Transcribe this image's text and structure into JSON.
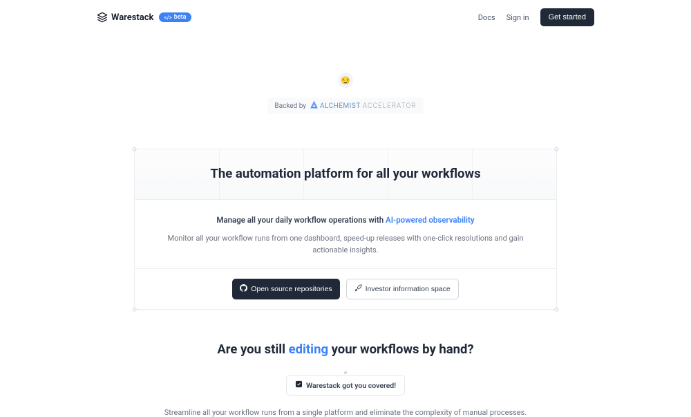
{
  "header": {
    "logo_text": "Warestack",
    "beta_label": "beta",
    "nav": {
      "docs": "Docs",
      "signin": "Sign in",
      "get_started": "Get started"
    }
  },
  "hero": {
    "backed_by": "Backed by",
    "accelerator_name": "ALCHEMIST",
    "accelerator_sub": "ACCELERATOR",
    "title": "The automation platform for all your workflows",
    "subtitle_prefix": "Manage all your daily workflow operations with ",
    "subtitle_highlight": "AI-powered observability",
    "description": "Monitor all your workflow runs from one dashboard, speed-up releases with one-click resolutions and gain actionable insights.",
    "cta_primary": "Open source repositories",
    "cta_secondary": "Investor information space"
  },
  "secondary": {
    "title_prefix": "Are you still ",
    "title_highlight": "editing",
    "title_suffix": " your workflows by hand?",
    "covered_label": "Warestack got you covered!",
    "description": "Streamline all your workflow runs from a single platform and eliminate the complexity of manual processes."
  }
}
